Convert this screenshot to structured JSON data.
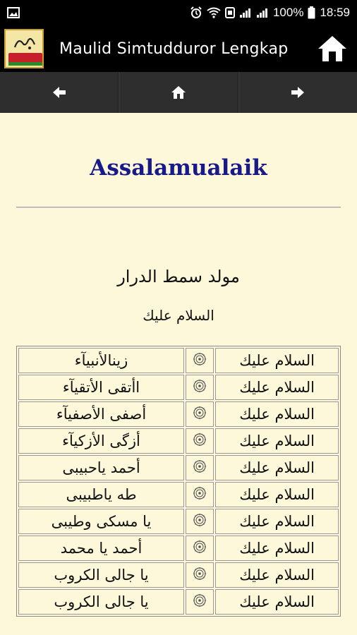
{
  "status_bar": {
    "battery": "100%",
    "time": "18:59"
  },
  "app_bar": {
    "title": "Maulid Simtudduror Lengkap",
    "logo_text": "MAULID",
    "home_icon": "home-icon"
  },
  "nav": {
    "back_icon": "arrow-left-icon",
    "home_icon": "home-icon",
    "forward_icon": "arrow-right-icon"
  },
  "content": {
    "title": "Assalamualaik",
    "section_title": "مولد سمط الدرار",
    "section_subtitle": "السلام عليك",
    "rows": [
      {
        "right": "السلام عليك",
        "left": "زينالأنبيآء"
      },
      {
        "right": "السلام عليك",
        "left": "اأتقى الأتقيآء"
      },
      {
        "right": "السلام عليك",
        "left": "أصفى الأصفيآء"
      },
      {
        "right": "السلام عليك",
        "left": "أزگى الأزكيآء"
      },
      {
        "right": "السلام عليك",
        "left": "أحمد ياحبيبى"
      },
      {
        "right": "السلام عليك",
        "left": "طه ياطبيبى"
      },
      {
        "right": "السلام عليك",
        "left": "يا مسكى وطيبى"
      },
      {
        "right": "السلام عليك",
        "left": "أحمد يا محمد"
      },
      {
        "right": "السلام عليك",
        "left": "يا جالى الكروب"
      },
      {
        "right": "السلام عليك",
        "left": "يا جالى الكروب"
      }
    ]
  },
  "colors": {
    "background": "#fdf8d9",
    "title": "#191a8a",
    "bar": "#000000",
    "nav": "#2e2e2e"
  }
}
